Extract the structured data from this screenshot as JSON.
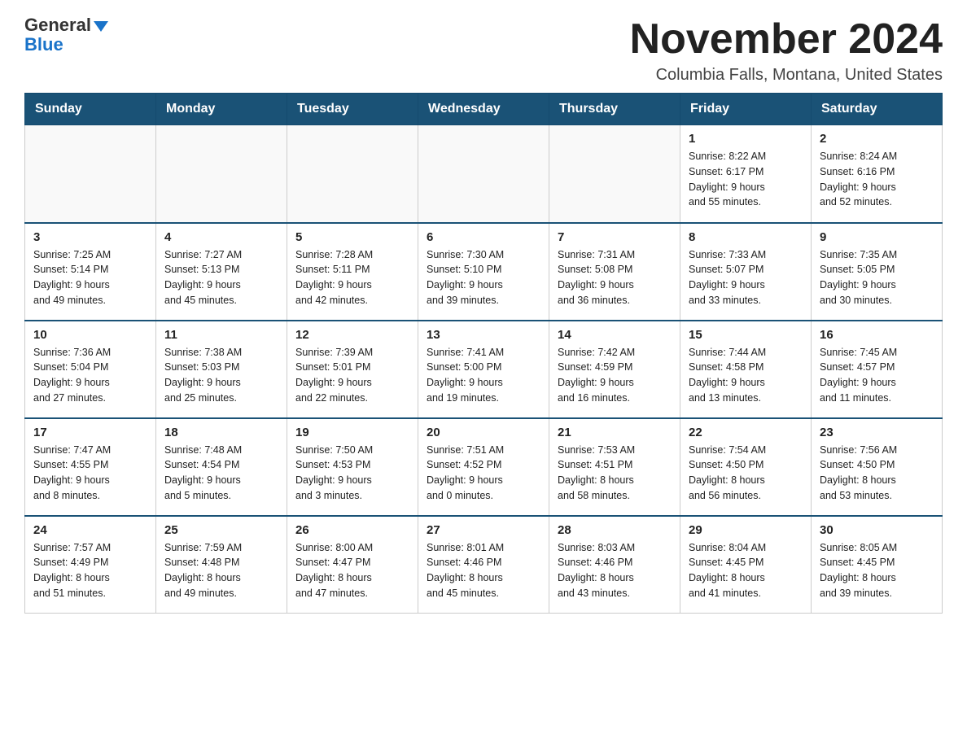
{
  "header": {
    "logo_general": "General",
    "logo_blue": "Blue",
    "month_title": "November 2024",
    "subtitle": "Columbia Falls, Montana, United States"
  },
  "weekdays": [
    "Sunday",
    "Monday",
    "Tuesday",
    "Wednesday",
    "Thursday",
    "Friday",
    "Saturday"
  ],
  "weeks": [
    {
      "days": [
        {
          "num": "",
          "info": ""
        },
        {
          "num": "",
          "info": ""
        },
        {
          "num": "",
          "info": ""
        },
        {
          "num": "",
          "info": ""
        },
        {
          "num": "",
          "info": ""
        },
        {
          "num": "1",
          "info": "Sunrise: 8:22 AM\nSunset: 6:17 PM\nDaylight: 9 hours\nand 55 minutes."
        },
        {
          "num": "2",
          "info": "Sunrise: 8:24 AM\nSunset: 6:16 PM\nDaylight: 9 hours\nand 52 minutes."
        }
      ]
    },
    {
      "days": [
        {
          "num": "3",
          "info": "Sunrise: 7:25 AM\nSunset: 5:14 PM\nDaylight: 9 hours\nand 49 minutes."
        },
        {
          "num": "4",
          "info": "Sunrise: 7:27 AM\nSunset: 5:13 PM\nDaylight: 9 hours\nand 45 minutes."
        },
        {
          "num": "5",
          "info": "Sunrise: 7:28 AM\nSunset: 5:11 PM\nDaylight: 9 hours\nand 42 minutes."
        },
        {
          "num": "6",
          "info": "Sunrise: 7:30 AM\nSunset: 5:10 PM\nDaylight: 9 hours\nand 39 minutes."
        },
        {
          "num": "7",
          "info": "Sunrise: 7:31 AM\nSunset: 5:08 PM\nDaylight: 9 hours\nand 36 minutes."
        },
        {
          "num": "8",
          "info": "Sunrise: 7:33 AM\nSunset: 5:07 PM\nDaylight: 9 hours\nand 33 minutes."
        },
        {
          "num": "9",
          "info": "Sunrise: 7:35 AM\nSunset: 5:05 PM\nDaylight: 9 hours\nand 30 minutes."
        }
      ]
    },
    {
      "days": [
        {
          "num": "10",
          "info": "Sunrise: 7:36 AM\nSunset: 5:04 PM\nDaylight: 9 hours\nand 27 minutes."
        },
        {
          "num": "11",
          "info": "Sunrise: 7:38 AM\nSunset: 5:03 PM\nDaylight: 9 hours\nand 25 minutes."
        },
        {
          "num": "12",
          "info": "Sunrise: 7:39 AM\nSunset: 5:01 PM\nDaylight: 9 hours\nand 22 minutes."
        },
        {
          "num": "13",
          "info": "Sunrise: 7:41 AM\nSunset: 5:00 PM\nDaylight: 9 hours\nand 19 minutes."
        },
        {
          "num": "14",
          "info": "Sunrise: 7:42 AM\nSunset: 4:59 PM\nDaylight: 9 hours\nand 16 minutes."
        },
        {
          "num": "15",
          "info": "Sunrise: 7:44 AM\nSunset: 4:58 PM\nDaylight: 9 hours\nand 13 minutes."
        },
        {
          "num": "16",
          "info": "Sunrise: 7:45 AM\nSunset: 4:57 PM\nDaylight: 9 hours\nand 11 minutes."
        }
      ]
    },
    {
      "days": [
        {
          "num": "17",
          "info": "Sunrise: 7:47 AM\nSunset: 4:55 PM\nDaylight: 9 hours\nand 8 minutes."
        },
        {
          "num": "18",
          "info": "Sunrise: 7:48 AM\nSunset: 4:54 PM\nDaylight: 9 hours\nand 5 minutes."
        },
        {
          "num": "19",
          "info": "Sunrise: 7:50 AM\nSunset: 4:53 PM\nDaylight: 9 hours\nand 3 minutes."
        },
        {
          "num": "20",
          "info": "Sunrise: 7:51 AM\nSunset: 4:52 PM\nDaylight: 9 hours\nand 0 minutes."
        },
        {
          "num": "21",
          "info": "Sunrise: 7:53 AM\nSunset: 4:51 PM\nDaylight: 8 hours\nand 58 minutes."
        },
        {
          "num": "22",
          "info": "Sunrise: 7:54 AM\nSunset: 4:50 PM\nDaylight: 8 hours\nand 56 minutes."
        },
        {
          "num": "23",
          "info": "Sunrise: 7:56 AM\nSunset: 4:50 PM\nDaylight: 8 hours\nand 53 minutes."
        }
      ]
    },
    {
      "days": [
        {
          "num": "24",
          "info": "Sunrise: 7:57 AM\nSunset: 4:49 PM\nDaylight: 8 hours\nand 51 minutes."
        },
        {
          "num": "25",
          "info": "Sunrise: 7:59 AM\nSunset: 4:48 PM\nDaylight: 8 hours\nand 49 minutes."
        },
        {
          "num": "26",
          "info": "Sunrise: 8:00 AM\nSunset: 4:47 PM\nDaylight: 8 hours\nand 47 minutes."
        },
        {
          "num": "27",
          "info": "Sunrise: 8:01 AM\nSunset: 4:46 PM\nDaylight: 8 hours\nand 45 minutes."
        },
        {
          "num": "28",
          "info": "Sunrise: 8:03 AM\nSunset: 4:46 PM\nDaylight: 8 hours\nand 43 minutes."
        },
        {
          "num": "29",
          "info": "Sunrise: 8:04 AM\nSunset: 4:45 PM\nDaylight: 8 hours\nand 41 minutes."
        },
        {
          "num": "30",
          "info": "Sunrise: 8:05 AM\nSunset: 4:45 PM\nDaylight: 8 hours\nand 39 minutes."
        }
      ]
    }
  ]
}
